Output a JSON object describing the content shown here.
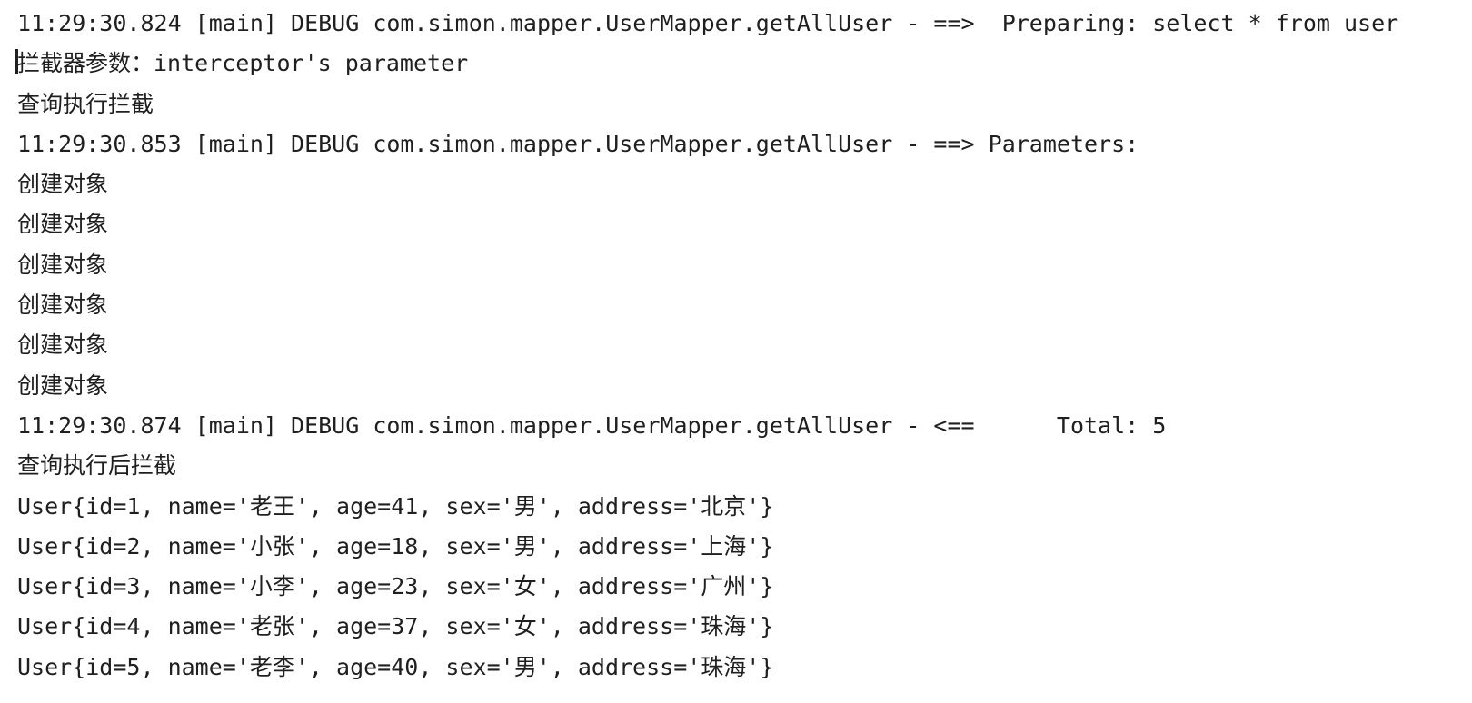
{
  "console": {
    "lines": [
      "11:29:30.824 [main] DEBUG com.simon.mapper.UserMapper.getAllUser - ==>  Preparing: select * from user",
      "拦截器参数：interceptor's parameter",
      "查询执行拦截",
      "11:29:30.853 [main] DEBUG com.simon.mapper.UserMapper.getAllUser - ==> Parameters: ",
      "创建对象",
      "创建对象",
      "创建对象",
      "创建对象",
      "创建对象",
      "创建对象",
      "11:29:30.874 [main] DEBUG com.simon.mapper.UserMapper.getAllUser - <==      Total: 5",
      "查询执行后拦截",
      "User{id=1, name='老王', age=41, sex='男', address='北京'}",
      "User{id=2, name='小张', age=18, sex='男', address='上海'}",
      "User{id=3, name='小李', age=23, sex='女', address='广州'}",
      "User{id=4, name='老张', age=37, sex='女', address='珠海'}",
      "User{id=5, name='老李', age=40, sex='男', address='珠海'}"
    ]
  }
}
